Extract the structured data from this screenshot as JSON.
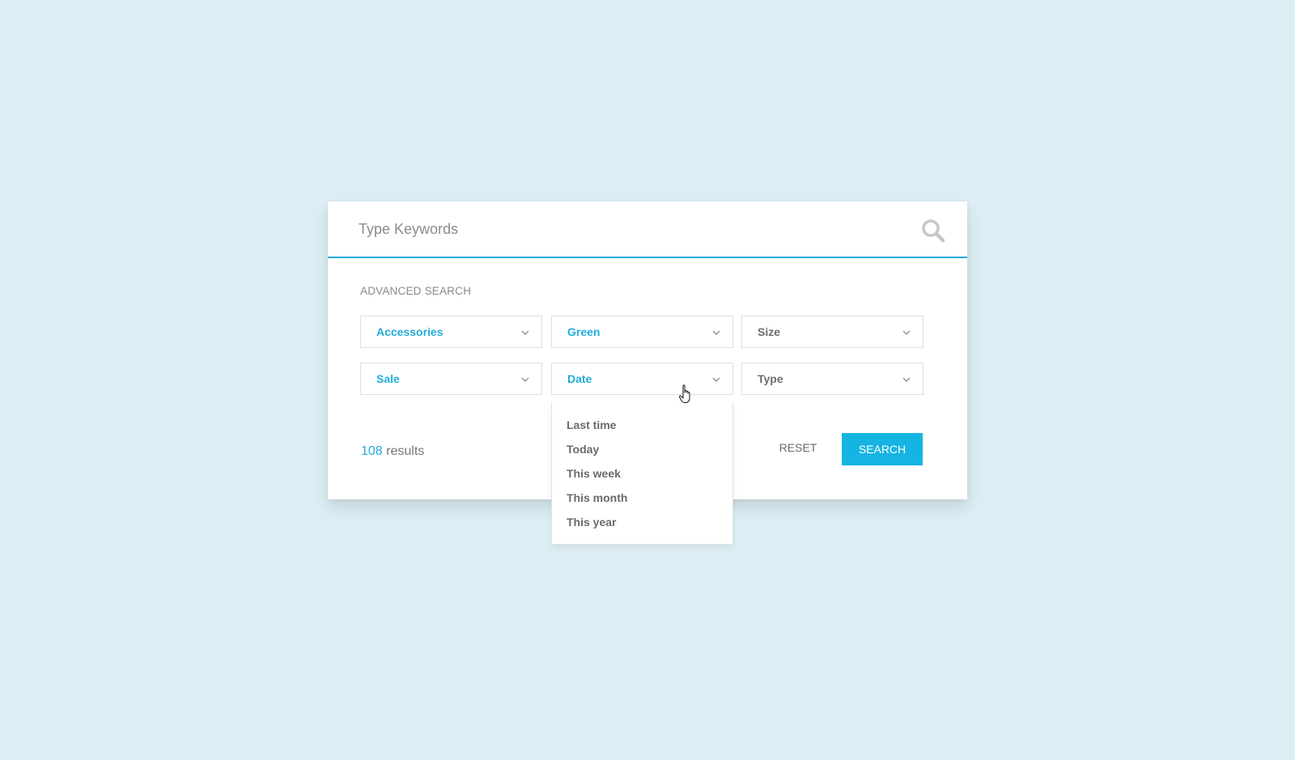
{
  "search": {
    "placeholder": "Type Keywords",
    "value": "",
    "icon": "search-icon"
  },
  "advanced": {
    "title": "ADVANCED SEARCH",
    "filters": [
      {
        "label": "Accessories",
        "state": "selected"
      },
      {
        "label": "Green",
        "state": "selected"
      },
      {
        "label": "Size",
        "state": "default"
      },
      {
        "label": "Sale",
        "state": "selected"
      },
      {
        "label": "Date",
        "state": "open"
      },
      {
        "label": "Type",
        "state": "default"
      }
    ]
  },
  "date_dropdown": {
    "options": [
      "Last time",
      "Today",
      "This week",
      "This month",
      "This year"
    ]
  },
  "results": {
    "count": "108",
    "suffix": " results"
  },
  "actions": {
    "reset_label": "RESET",
    "search_label": "SEARCH"
  },
  "colors": {
    "background": "#dcedf4",
    "accent": "#22acd9",
    "button": "#16b4e3",
    "muted_text": "#6d6d6d"
  }
}
